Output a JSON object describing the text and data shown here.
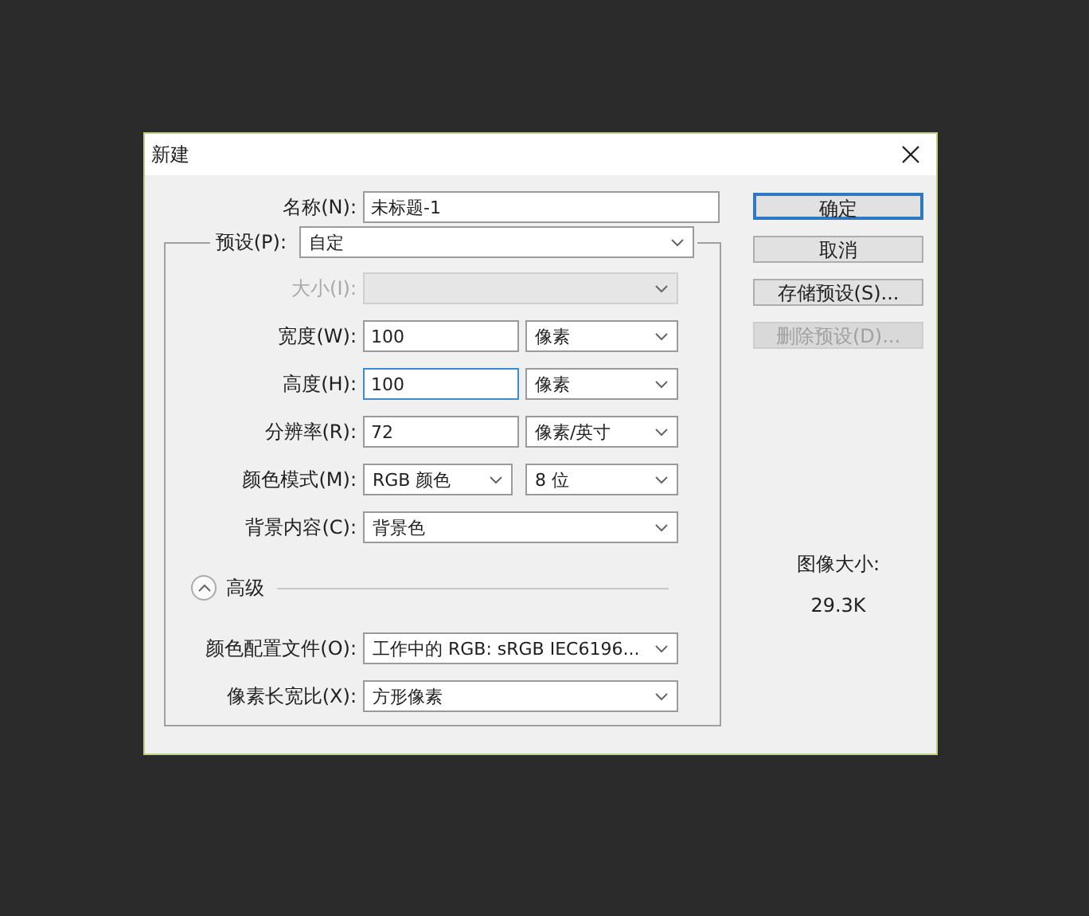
{
  "window": {
    "title": "新建"
  },
  "name_field": {
    "label": "名称(N):",
    "value": "未标题-1"
  },
  "preset": {
    "label": "预设(P):",
    "value": "自定"
  },
  "rows": [
    {
      "label": "大小(I):",
      "disabled": true,
      "controls": [
        {
          "kind": "select",
          "focused": false
        }
      ]
    },
    {
      "label": "宽度(W):",
      "disabled": false,
      "controls": [
        {
          "kind": "input",
          "value": "100",
          "focused": false
        },
        {
          "kind": "select",
          "value": "像素",
          "focused": false
        }
      ]
    },
    {
      "label": "高度(H):",
      "disabled": false,
      "controls": [
        {
          "kind": "input",
          "value": "100",
          "focused": true
        },
        {
          "kind": "select",
          "value": "像素",
          "focused": false
        }
      ]
    },
    {
      "label": "分辨率(R):",
      "disabled": false,
      "controls": [
        {
          "kind": "input",
          "value": "72",
          "focused": false
        },
        {
          "kind": "select",
          "value": "像素/英寸",
          "focused": false
        }
      ]
    },
    {
      "label": "颜色模式(M):",
      "disabled": false,
      "controls": [
        {
          "kind": "select",
          "value": "RGB 颜色",
          "focused": false
        },
        {
          "kind": "select",
          "value": "8 位",
          "focused": false
        }
      ]
    },
    {
      "label": "背景内容(C):",
      "disabled": false,
      "controls": [
        {
          "kind": "select",
          "value": "背景色",
          "focused": false
        }
      ]
    }
  ],
  "advanced": {
    "label": "高级",
    "expanded": true
  },
  "advanced_rows": [
    {
      "label": "颜色配置文件(O):",
      "disabled": false,
      "controls": [
        {
          "kind": "select",
          "value": "工作中的 RGB: sRGB IEC6196...",
          "focused": false
        }
      ]
    },
    {
      "label": "像素长宽比(X):",
      "disabled": false,
      "controls": [
        {
          "kind": "select",
          "value": "方形像素",
          "focused": false
        }
      ]
    }
  ],
  "buttons": [
    {
      "label": "确定",
      "default": true,
      "disabled": false
    },
    {
      "label": "取消",
      "default": false,
      "disabled": false
    },
    {
      "label": "存储预设(S)...",
      "default": false,
      "disabled": false
    },
    {
      "label": "删除预设(D)...",
      "default": false,
      "disabled": true
    }
  ],
  "image_size": {
    "label": "图像大小:",
    "value": "29.3K"
  }
}
